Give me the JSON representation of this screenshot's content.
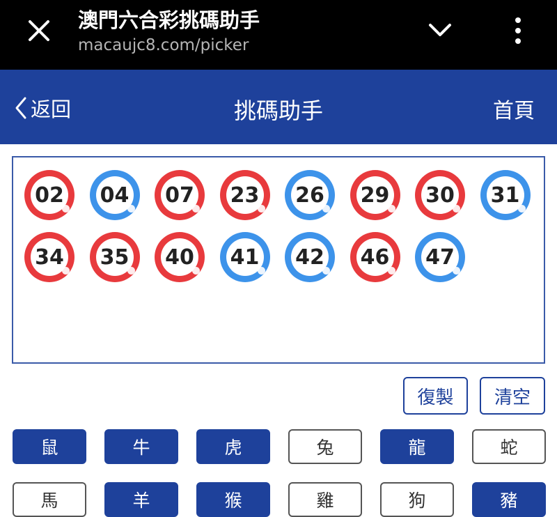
{
  "browser": {
    "title": "澳門六合彩挑碼助手",
    "url": "macaujc8.com/picker"
  },
  "header": {
    "back_label": "返回",
    "title": "挑碼助手",
    "home_label": "首頁",
    "color": "#1e419b"
  },
  "selected_numbers": [
    {
      "num": "02",
      "color": "red"
    },
    {
      "num": "04",
      "color": "blue"
    },
    {
      "num": "07",
      "color": "red"
    },
    {
      "num": "23",
      "color": "red"
    },
    {
      "num": "26",
      "color": "blue"
    },
    {
      "num": "29",
      "color": "red"
    },
    {
      "num": "30",
      "color": "red"
    },
    {
      "num": "31",
      "color": "blue"
    },
    {
      "num": "34",
      "color": "red"
    },
    {
      "num": "35",
      "color": "red"
    },
    {
      "num": "40",
      "color": "red"
    },
    {
      "num": "41",
      "color": "blue"
    },
    {
      "num": "42",
      "color": "blue"
    },
    {
      "num": "46",
      "color": "red"
    },
    {
      "num": "47",
      "color": "blue"
    }
  ],
  "actions": {
    "copy_label": "復製",
    "clear_label": "清空"
  },
  "zodiacs": [
    {
      "label": "鼠",
      "selected": true
    },
    {
      "label": "牛",
      "selected": true
    },
    {
      "label": "虎",
      "selected": true
    },
    {
      "label": "兔",
      "selected": false
    },
    {
      "label": "龍",
      "selected": true
    },
    {
      "label": "蛇",
      "selected": false
    },
    {
      "label": "馬",
      "selected": false
    },
    {
      "label": "羊",
      "selected": true
    },
    {
      "label": "猴",
      "selected": true
    },
    {
      "label": "雞",
      "selected": false
    },
    {
      "label": "狗",
      "selected": false
    },
    {
      "label": "豬",
      "selected": true
    }
  ],
  "colors": {
    "red_ball": "#e83a3d",
    "blue_ball": "#3d93ea"
  }
}
